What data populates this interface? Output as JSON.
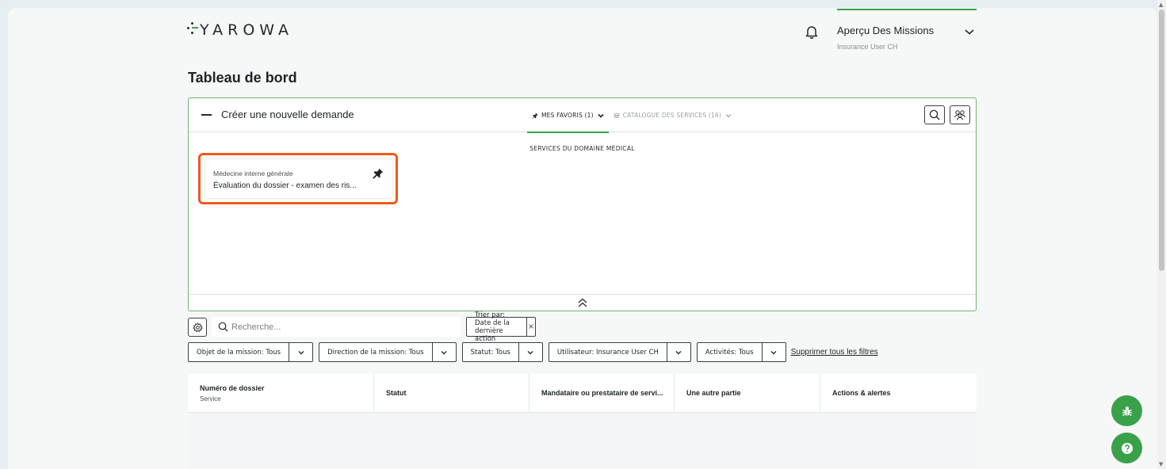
{
  "colors": {
    "accent": "#3aa14b",
    "highlight": "#f05a1a",
    "text": "#1f2326",
    "muted": "#8a8f93"
  },
  "brand": {
    "logo_text": "YAROWA"
  },
  "topnav": {
    "bell_icon": "bell-icon",
    "title": "Aperçu Des Missions",
    "subtitle": "Insurance User CH",
    "chevron_icon": "chevron-down-icon"
  },
  "page": {
    "title": "Tableau de bord"
  },
  "request_panel": {
    "collapse_icon": "minus-icon",
    "title": "Créer une nouvelle demande",
    "tabs": [
      {
        "label": "MES FAVORIS (1)",
        "icon": "pin-icon",
        "active": true
      },
      {
        "label": "CATALOGUE DES SERVICES (16)",
        "icon": "stack-icon",
        "active": false
      }
    ],
    "search_icon": "search-icon",
    "people_icon": "group-icon",
    "section_label": "SERVICES DU DOMAINE MÉDICAL",
    "favorite": {
      "category": "Médecine interne générale",
      "service": "Évaluation du dossier - examen des ris...",
      "pin_icon": "pin-icon"
    },
    "collapse_up_icon": "double-chevron-up-icon"
  },
  "toolbar": {
    "settings_icon": "gear-icon",
    "search_placeholder": "Recherche...",
    "sort_label": "Trier par: Date de la dernière action",
    "sort_clear": "×"
  },
  "filters": [
    {
      "label": "Objet de la mission: Tous"
    },
    {
      "label": "Direction de la mission: Tous"
    },
    {
      "label": "Statut: Tous"
    },
    {
      "label": "Utilisateur: Insurance User CH"
    },
    {
      "label": "Activités: Tous"
    }
  ],
  "clear_filters": "Supprimer tous les filtres",
  "table": {
    "columns": [
      {
        "title": "Numéro de dossier",
        "subtitle": "Service"
      },
      {
        "title": "Statut"
      },
      {
        "title": "Mandataire ou prestataire de servi..."
      },
      {
        "title": "Une autre partie"
      },
      {
        "title": "Actions & alertes"
      }
    ]
  },
  "fabs": [
    {
      "icon": "bug-icon"
    },
    {
      "icon": "help-icon"
    }
  ]
}
